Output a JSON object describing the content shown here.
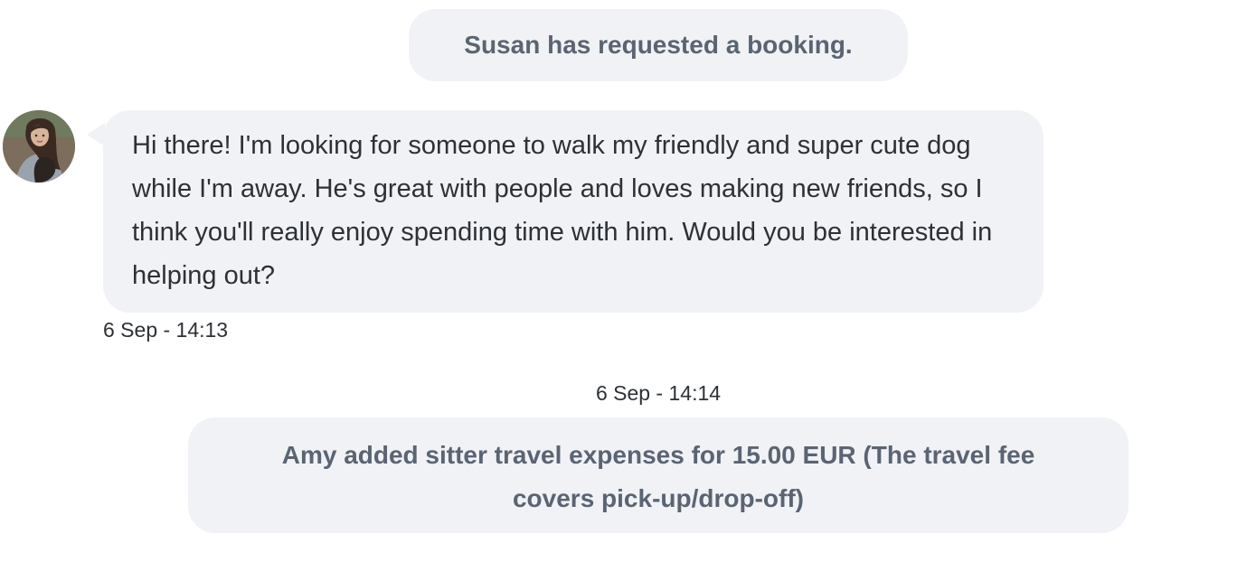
{
  "conversation": {
    "system_message_1": "Susan has requested a booking.",
    "message": {
      "avatar": "user-avatar-photo",
      "text": "Hi there! I'm looking for someone to walk my friendly and super cute dog while I'm away. He's great with people and loves making new friends, so I think you'll really enjoy spending time with him. Would you be interested in helping out?",
      "timestamp": "6 Sep - 14:13"
    },
    "timestamp_2": "6 Sep - 14:14",
    "system_message_2": "Amy added sitter travel expenses for 15.00 EUR (The travel fee covers pick-up/drop-off)"
  },
  "colors": {
    "bubble_bg": "#f0f2f6",
    "system_text": "#5a6472",
    "message_text": "#2d3136"
  }
}
